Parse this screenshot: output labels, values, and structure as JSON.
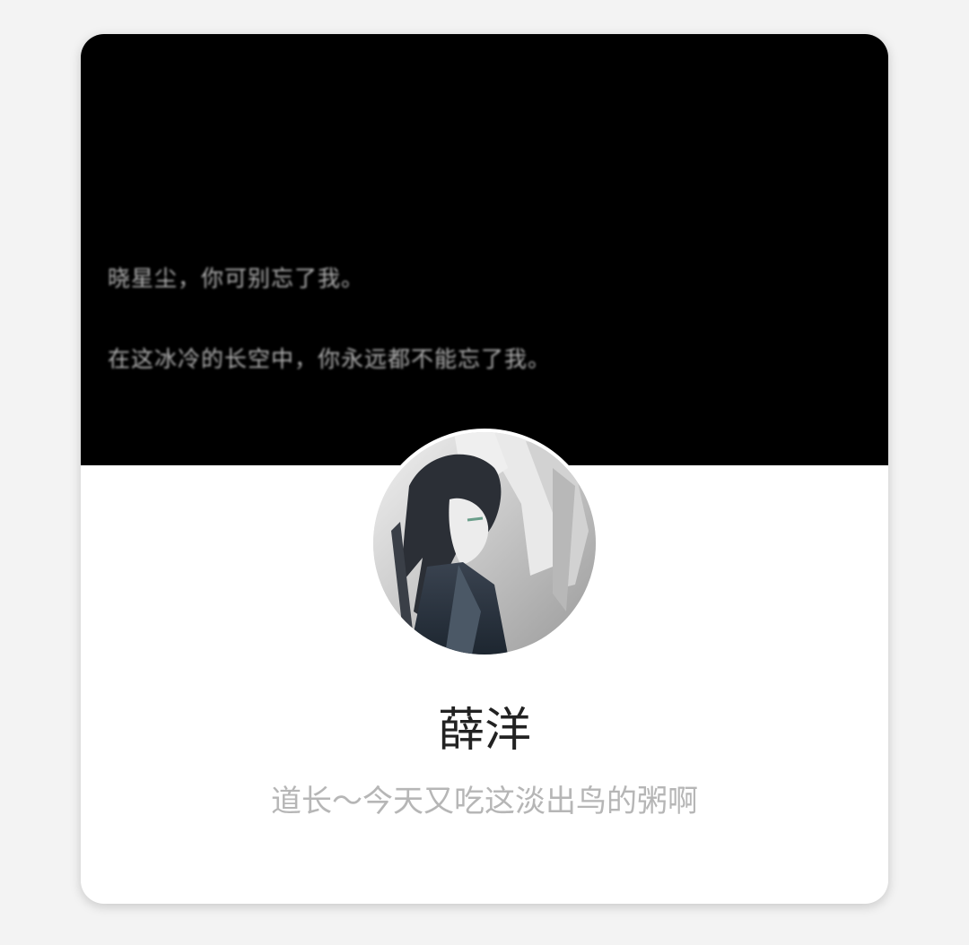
{
  "cover": {
    "lines": [
      "晓星尘，你可别忘了我。",
      "在这冰冷的长空中，你永远都不能忘了我。"
    ]
  },
  "profile": {
    "name": "薛洋",
    "bio": "道长～今天又吃这淡出鸟的粥啊"
  },
  "colors": {
    "cover_bg": "#000000",
    "card_bg": "#ffffff",
    "name": "#222222",
    "bio": "#b6b6b6"
  }
}
